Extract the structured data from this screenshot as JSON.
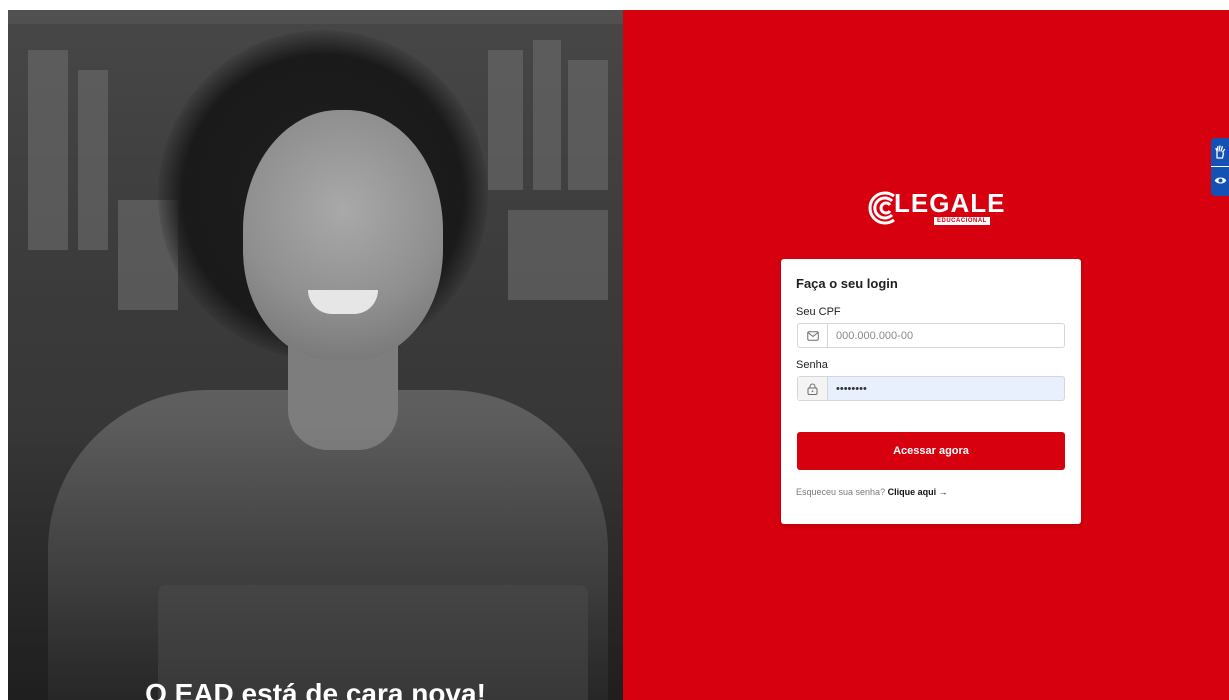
{
  "hero": {
    "headline": "O EAD está de cara nova!"
  },
  "brand": {
    "name": "LEGALE",
    "subtitle": "EDUCACIONAL",
    "primary_color": "#d7000f"
  },
  "login": {
    "title": "Faça o seu login",
    "cpf_label": "Seu CPF",
    "cpf_placeholder": "000.000.000-00",
    "cpf_icon": "mail-icon",
    "password_label": "Senha",
    "password_value": "••••••••",
    "password_icon": "lock-icon",
    "submit_label": "Acessar agora",
    "forgot_prompt": "Esqueceu sua senha?",
    "forgot_link": "Clique aqui →"
  },
  "accessibility": {
    "buttons": [
      "hand-sign-icon",
      "eye-icon"
    ],
    "color": "#1351b4"
  }
}
